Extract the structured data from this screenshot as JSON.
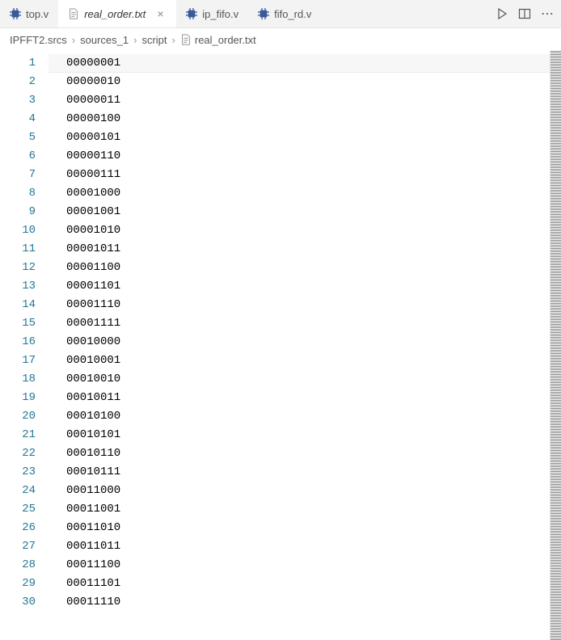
{
  "tabs": [
    {
      "label": "top.v",
      "type": "verilog",
      "active": false
    },
    {
      "label": "real_order.txt",
      "type": "document",
      "active": true
    },
    {
      "label": "ip_fifo.v",
      "type": "verilog",
      "active": false
    },
    {
      "label": "fifo_rd.v",
      "type": "verilog",
      "active": false
    }
  ],
  "breadcrumb": {
    "items": [
      "IPFFT2.srcs",
      "sources_1",
      "script",
      "real_order.txt"
    ]
  },
  "lines": [
    "00000001",
    "00000010",
    "00000011",
    "00000100",
    "00000101",
    "00000110",
    "00000111",
    "00001000",
    "00001001",
    "00001010",
    "00001011",
    "00001100",
    "00001101",
    "00001110",
    "00001111",
    "00010000",
    "00010001",
    "00010010",
    "00010011",
    "00010100",
    "00010101",
    "00010110",
    "00010111",
    "00011000",
    "00011001",
    "00011010",
    "00011011",
    "00011100",
    "00011101",
    "00011110"
  ]
}
